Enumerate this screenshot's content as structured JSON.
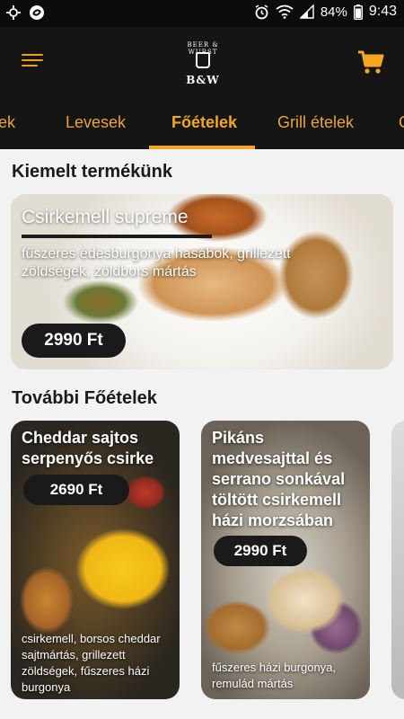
{
  "status_bar": {
    "battery": "84%",
    "time": "9:43"
  },
  "app_bar": {
    "logo_arc_text": "BEER & WURST",
    "logo_text": "B&W"
  },
  "tabs": [
    {
      "label": "ek"
    },
    {
      "label": "Levesek"
    },
    {
      "label": "Főételek",
      "active": true
    },
    {
      "label": "Grill ételek"
    },
    {
      "label": "G"
    }
  ],
  "featured": {
    "section_title": "Kiemelt termékünk",
    "name": "Csirkemell supreme",
    "description": "fűszeres édesburgonya hasábok, grillezett zöldségek, zöldbors mártás",
    "price": "2990 Ft"
  },
  "more": {
    "section_title": "További  Főételek",
    "products": [
      {
        "name": "Cheddar sajtos serpenyős csirke",
        "price": "2690 Ft",
        "description": "csirkemell, borsos cheddar sajtmártás, grillezett zöldségek, fűszeres házi burgonya"
      },
      {
        "name": "Pikáns medvesajttal és serrano sonkával töltött csirkemell házi morzsában",
        "price": "2990 Ft",
        "description": "fűszeres házi burgonya, remulád mártás"
      }
    ]
  },
  "colors": {
    "accent": "#f5a623",
    "header_bg": "#151515",
    "content_bg": "#f2f2f2"
  }
}
